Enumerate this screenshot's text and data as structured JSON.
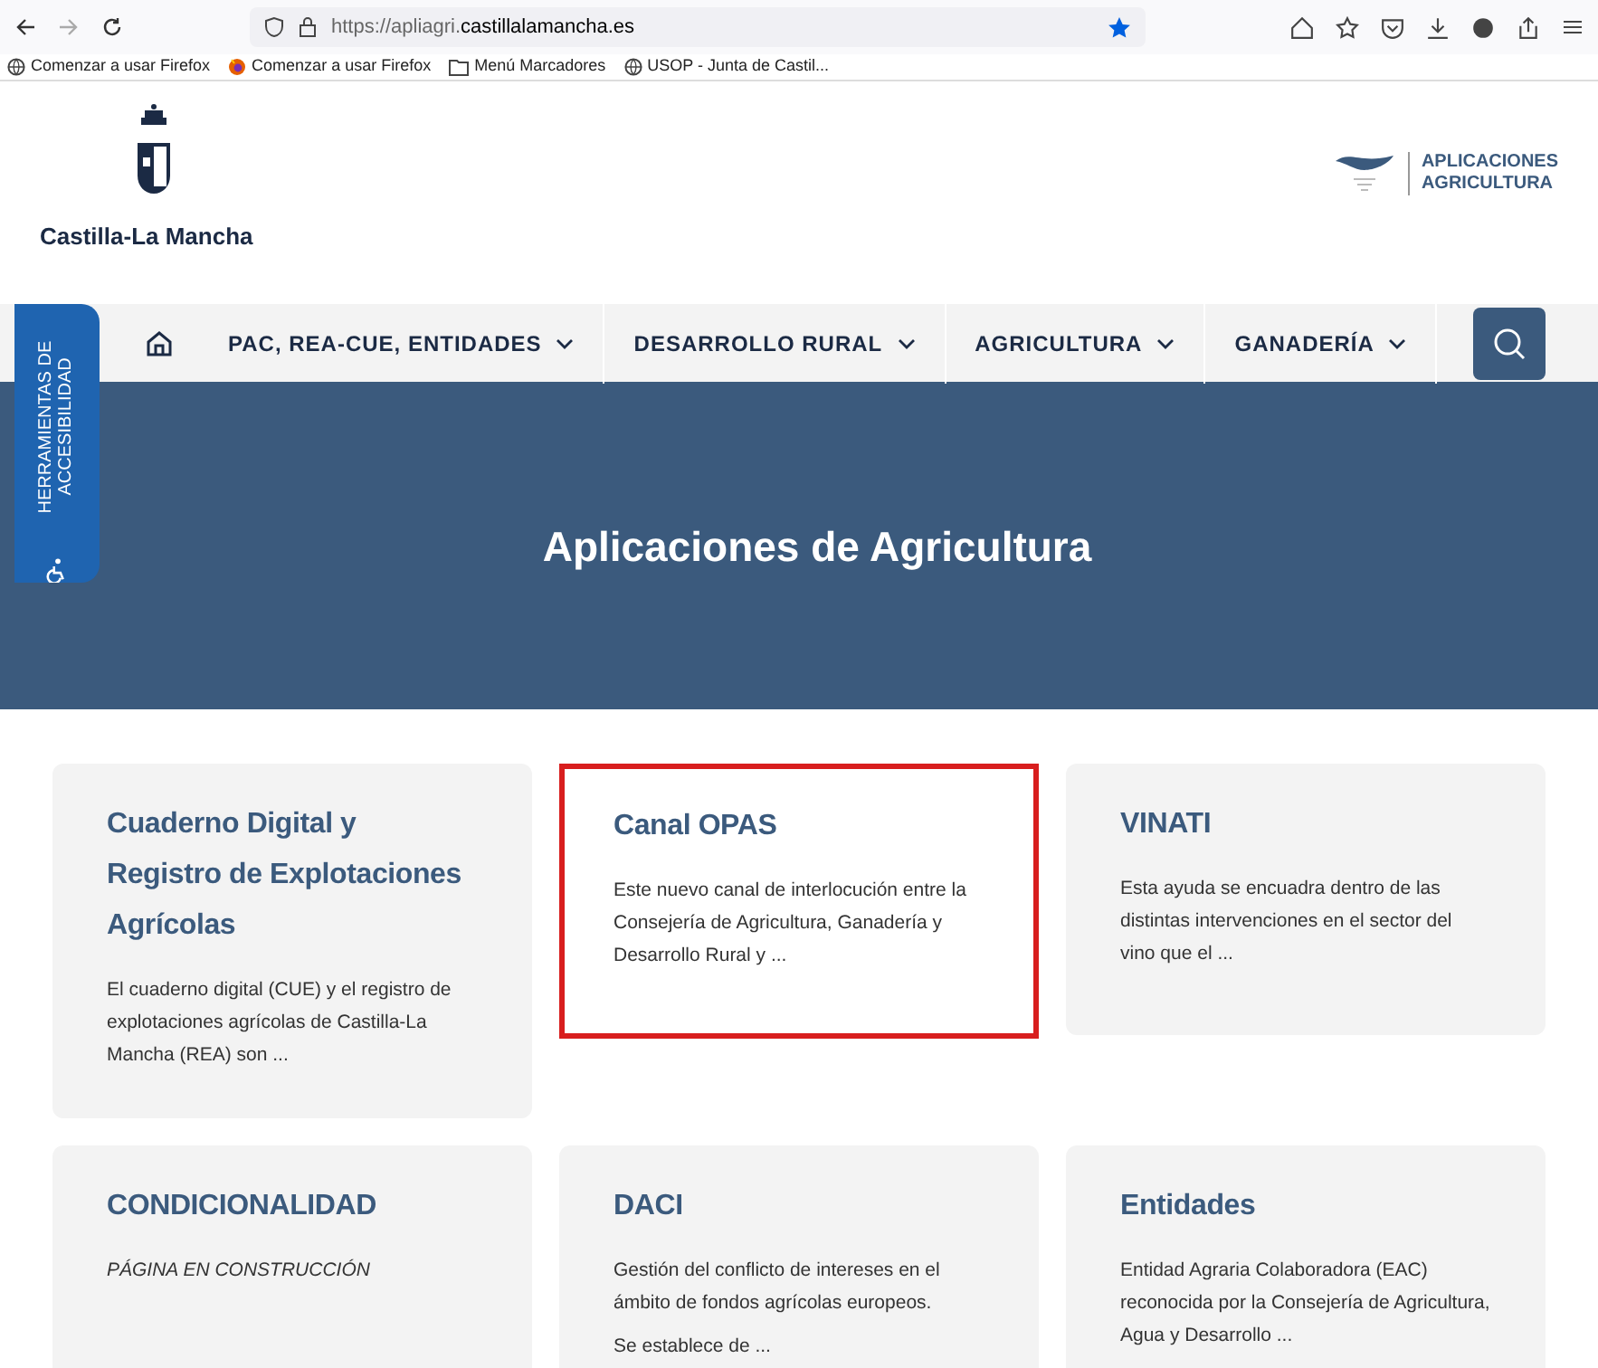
{
  "browser": {
    "url_prefix": "https://apliagri.",
    "url_domain": "castillalamancha.es",
    "bookmarked": true
  },
  "bookmarks": [
    {
      "label": "Comenzar a usar Firefox",
      "kind": "globe"
    },
    {
      "label": "Comenzar a usar Firefox",
      "kind": "firefox"
    },
    {
      "label": "Menú Marcadores",
      "kind": "folder"
    },
    {
      "label": "USOP - Junta de Castil...",
      "kind": "globe"
    }
  ],
  "header": {
    "logo_text": "Castilla-La Mancha",
    "app_logo_lines": [
      "APLICACIONES",
      "AGRICULTURA"
    ]
  },
  "accessibility_tab": {
    "label": "HERRAMIENTAS DE ACCESIBILIDAD"
  },
  "nav": [
    {
      "label": "PAC, REA-CUE, ENTIDADES"
    },
    {
      "label": "DESARROLLO RURAL"
    },
    {
      "label": "AGRICULTURA"
    },
    {
      "label": "GANADERÍA"
    }
  ],
  "hero": {
    "title": "Aplicaciones de Agricultura"
  },
  "cards": [
    {
      "title": "Cuaderno Digital y Registro de Explotaciones Agrícolas",
      "paragraphs": [
        "El cuaderno digital (CUE) y el registro de explotaciones agrícolas de Castilla-La Mancha (REA) son ..."
      ],
      "italic": false,
      "highlighted": false
    },
    {
      "title": "Canal OPAS",
      "paragraphs": [
        "Este nuevo canal de interlocución entre la Consejería de Agricultura, Ganadería y Desarrollo Rural y ..."
      ],
      "italic": false,
      "highlighted": true
    },
    {
      "title": "VINATI",
      "paragraphs": [
        "Esta ayuda se encuadra dentro de las distintas intervenciones en el sector del vino que el ..."
      ],
      "italic": false,
      "highlighted": false
    },
    {
      "title": "CONDICIONALIDAD",
      "paragraphs": [
        "PÁGINA EN CONSTRUCCIÓN"
      ],
      "italic": true,
      "highlighted": false
    },
    {
      "title": "DACI",
      "paragraphs": [
        "Gestión del conflicto de intereses en el ámbito de fondos agrícolas europeos.",
        "Se establece de ..."
      ],
      "italic": false,
      "highlighted": false
    },
    {
      "title": "Entidades",
      "paragraphs": [
        "Entidad Agraria Colaboradora (EAC) reconocida por la Consejería de Agricultura, Agua y Desarrollo ..."
      ],
      "italic": false,
      "highlighted": false
    }
  ]
}
